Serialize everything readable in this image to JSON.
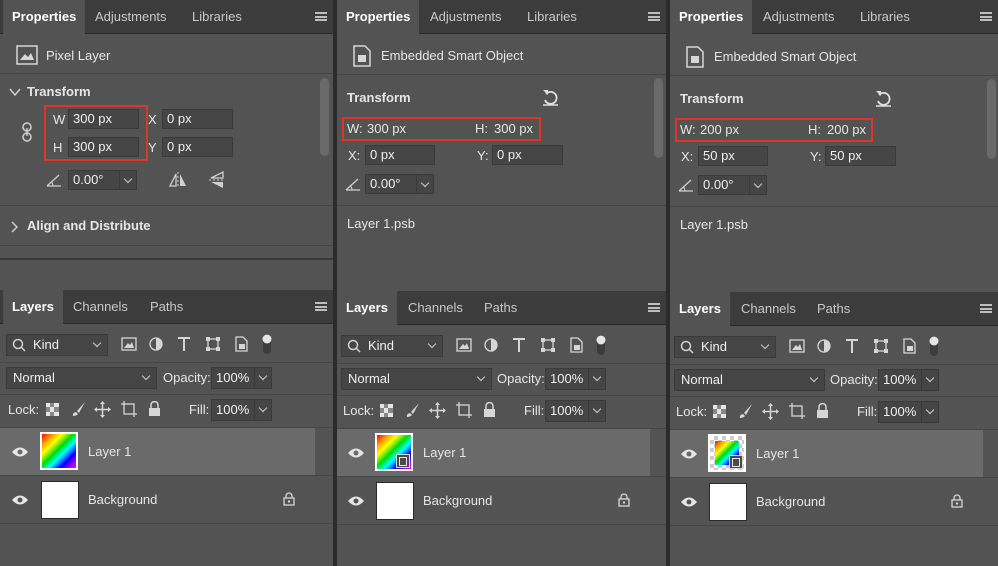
{
  "panels": [
    {
      "props_tabs": [
        "Properties",
        "Adjustments",
        "Libraries"
      ],
      "header_label": "Pixel Layer",
      "section_title": "Transform",
      "w_label": "W",
      "w_value": "300 px",
      "h_label": "H",
      "h_value": "300 px",
      "x_label": "X",
      "x_value": "0 px",
      "y_label": "Y",
      "y_value": "0 px",
      "angle_value": "0.00°",
      "align_title": "Align and Distribute",
      "layers_tabs": [
        "Layers",
        "Channels",
        "Paths"
      ],
      "kind": "Kind",
      "blend": "Normal",
      "opacity_label": "Opacity:",
      "opacity_value": "100%",
      "lock_label": "Lock:",
      "fill_label": "Fill:",
      "fill_value": "100%",
      "layer1": "Layer 1",
      "background": "Background"
    },
    {
      "props_tabs": [
        "Properties",
        "Adjustments",
        "Libraries"
      ],
      "header_label": "Embedded Smart Object",
      "section_title": "Transform",
      "w_label": "W:",
      "w_value": "300 px",
      "h_label": "H:",
      "h_value": "300 px",
      "x_label": "X:",
      "x_value": "0 px",
      "y_label": "Y:",
      "y_value": "0 px",
      "angle_value": "0.00°",
      "file_name": "Layer 1.psb",
      "layers_tabs": [
        "Layers",
        "Channels",
        "Paths"
      ],
      "kind": "Kind",
      "blend": "Normal",
      "opacity_label": "Opacity:",
      "opacity_value": "100%",
      "lock_label": "Lock:",
      "fill_label": "Fill:",
      "fill_value": "100%",
      "layer1": "Layer 1",
      "background": "Background"
    },
    {
      "props_tabs": [
        "Properties",
        "Adjustments",
        "Libraries"
      ],
      "header_label": "Embedded Smart Object",
      "section_title": "Transform",
      "w_label": "W:",
      "w_value": "200 px",
      "h_label": "H:",
      "h_value": "200 px",
      "x_label": "X:",
      "x_value": "50 px",
      "y_label": "Y:",
      "y_value": "50 px",
      "angle_value": "0.00°",
      "file_name": "Layer 1.psb",
      "layers_tabs": [
        "Layers",
        "Channels",
        "Paths"
      ],
      "kind": "Kind",
      "blend": "Normal",
      "opacity_label": "Opacity:",
      "opacity_value": "100%",
      "lock_label": "Lock:",
      "fill_label": "Fill:",
      "fill_value": "100%",
      "layer1": "Layer 1",
      "background": "Background"
    }
  ],
  "colors": {
    "panel_bg": "#535353",
    "tab_bar_bg": "#3c3c3c",
    "field_bg": "#454545",
    "highlight_red": "#e0342a",
    "selected_row": "#6a6a6a"
  },
  "icons": [
    "pixel-layer-icon",
    "smart-object-icon",
    "link-icon",
    "angle-icon",
    "flip-horizontal-icon",
    "flip-vertical-icon",
    "reset-icon",
    "eye-icon",
    "lock-icon",
    "search-icon",
    "image-filter-icon",
    "adjustment-filter-icon",
    "type-filter-icon",
    "shape-filter-icon",
    "smart-filter-icon",
    "filter-toggle-icon",
    "lock-transparent-icon",
    "lock-image-icon",
    "lock-position-icon",
    "lock-artboard-icon",
    "lock-all-icon"
  ]
}
